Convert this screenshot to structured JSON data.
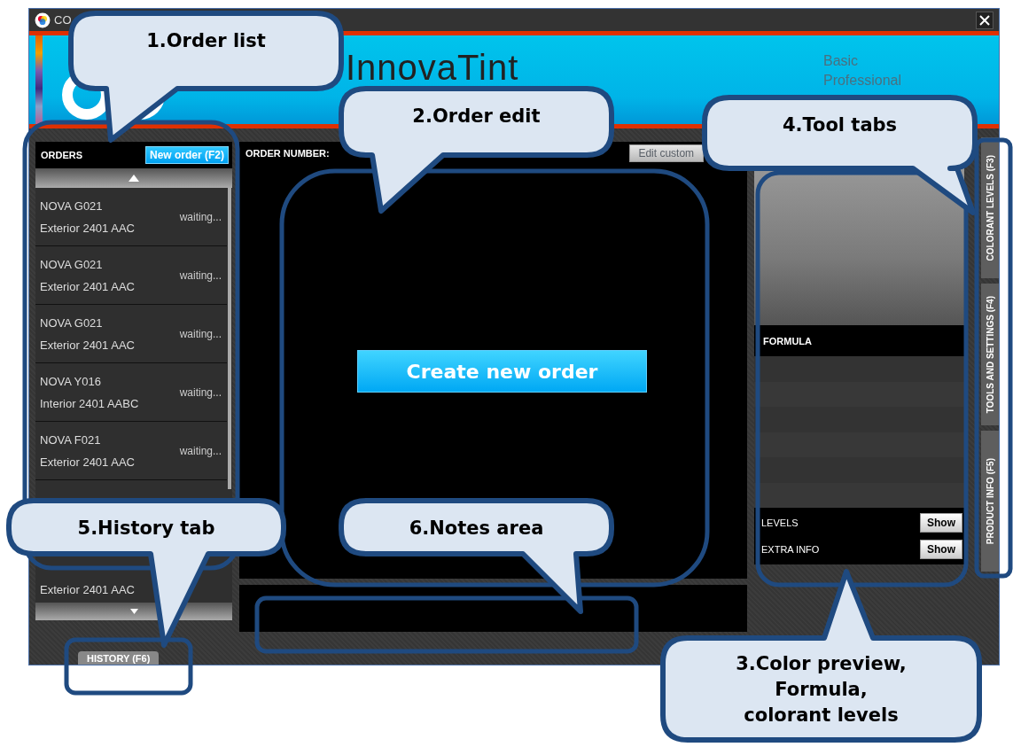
{
  "window": {
    "title": "CO"
  },
  "banner": {
    "logo_text": "InnovaTint",
    "editions": [
      "Basic",
      "Professional"
    ]
  },
  "orders": {
    "title": "ORDERS",
    "new_button": "New order (F2)",
    "items": [
      {
        "line1": "NOVA G021",
        "line2": "Exterior 2401 AAC",
        "status": "waiting..."
      },
      {
        "line1": "NOVA G021",
        "line2": "Exterior 2401 AAC",
        "status": "waiting..."
      },
      {
        "line1": "NOVA G021",
        "line2": "Exterior 2401 AAC",
        "status": "waiting..."
      },
      {
        "line1": "NOVA Y016",
        "line2": "Interior 2401 AABC",
        "status": "waiting..."
      },
      {
        "line1": "NOVA F021",
        "line2": "Exterior 2401 AAC",
        "status": "waiting..."
      },
      {
        "line2": "Exterior 2401 AAC"
      }
    ]
  },
  "order_edit": {
    "number_label": "ORDER NUMBER:",
    "edit_customer_button": {
      "label": "Edit custom",
      "disabled": true
    },
    "create_button": "Create new order"
  },
  "right_panel": {
    "formula_title": "FORMULA",
    "options": [
      {
        "label": "LEVELS",
        "button": "Show"
      },
      {
        "label": "EXTRA INFO",
        "button": "Show"
      }
    ]
  },
  "tool_tabs": [
    {
      "label": "COLORANT LEVELS (F3)"
    },
    {
      "label": "TOOLS AND SETTINGS (F4)"
    },
    {
      "label": "PRODUCT INFO (F5)"
    }
  ],
  "history_tab": "HISTORY (F6)",
  "callouts": [
    {
      "lines": [
        "1.Order list"
      ]
    },
    {
      "lines": [
        "2.Order edit"
      ]
    },
    {
      "lines": [
        "4.Tool tabs"
      ]
    },
    {
      "lines": [
        "5.History tab"
      ]
    },
    {
      "lines": [
        "6.Notes area"
      ]
    },
    {
      "lines": [
        "3.Color preview,",
        "Formula,",
        "colorant levels"
      ]
    }
  ]
}
